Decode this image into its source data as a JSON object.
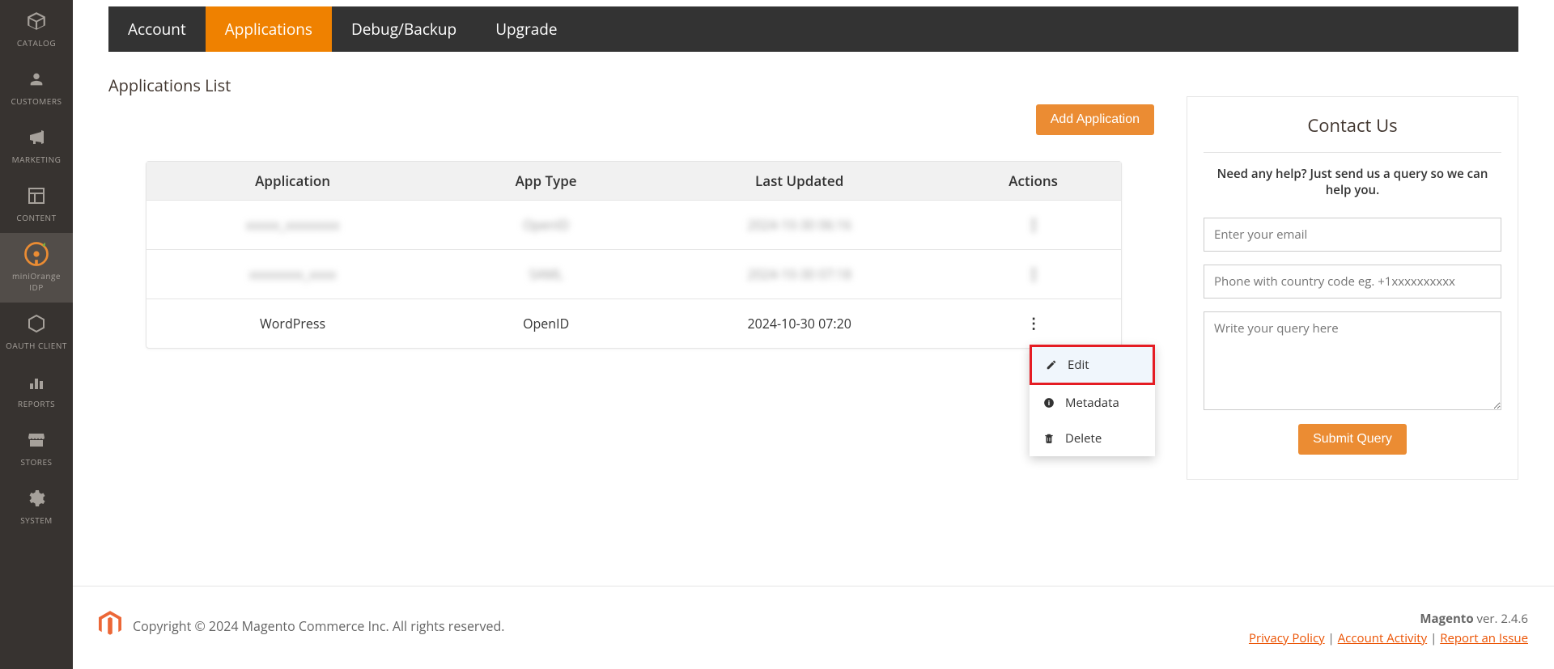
{
  "sidebar": {
    "items": [
      {
        "label": "CATALOG"
      },
      {
        "label": "CUSTOMERS"
      },
      {
        "label": "MARKETING"
      },
      {
        "label": "CONTENT"
      },
      {
        "label": "miniOrange IDP"
      },
      {
        "label": "OAUTH CLIENT"
      },
      {
        "label": "REPORTS"
      },
      {
        "label": "STORES"
      },
      {
        "label": "SYSTEM"
      }
    ]
  },
  "tabs": {
    "account": "Account",
    "applications": "Applications",
    "debug": "Debug/Backup",
    "upgrade": "Upgrade"
  },
  "page": {
    "title": "Applications List",
    "add_button": "Add Application"
  },
  "table": {
    "headers": {
      "application": "Application",
      "app_type": "App Type",
      "last_updated": "Last Updated",
      "actions": "Actions"
    },
    "rows": [
      {
        "application": "xxxxx_xxxxxxxx",
        "app_type": "OpenID",
        "last_updated": "2024-10-30 06:16",
        "blurred": true
      },
      {
        "application": "xxxxxxxx_xxxx",
        "app_type": "SAML",
        "last_updated": "2024-10-30 07:18",
        "blurred": true
      },
      {
        "application": "WordPress",
        "app_type": "OpenID",
        "last_updated": "2024-10-30 07:20",
        "blurred": false
      }
    ]
  },
  "dropdown": {
    "edit": "Edit",
    "metadata": "Metadata",
    "delete": "Delete"
  },
  "contact": {
    "title": "Contact Us",
    "subtitle": "Need any help? Just send us a query so we can help you.",
    "email_placeholder": "Enter your email",
    "phone_placeholder": "Phone with country code eg. +1xxxxxxxxxx",
    "query_placeholder": "Write your query here",
    "submit": "Submit Query"
  },
  "footer": {
    "copyright": "Copyright © 2024 Magento Commerce Inc. All rights reserved.",
    "product": "Magento",
    "version": " ver. 2.4.6",
    "privacy": "Privacy Policy",
    "activity": " Account Activity",
    "report": "Report an Issue"
  }
}
